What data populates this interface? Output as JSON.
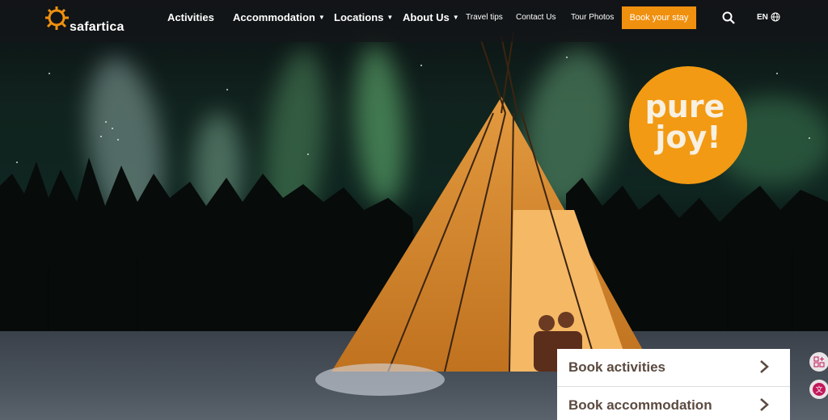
{
  "brand": {
    "name": "safartica"
  },
  "nav": {
    "activities": "Activities",
    "accommodation": "Accommodation",
    "locations": "Locations",
    "about_us": "About Us",
    "travel_tips": "Travel tips",
    "contact_us": "Contact Us",
    "tour_photos": "Tour Photos",
    "book_stay": "Book your stay",
    "language": "EN"
  },
  "badge": {
    "line1": "pure",
    "line2": "joy!"
  },
  "cards": {
    "activities": "Book activities",
    "accommodation": "Book accommodation"
  },
  "colors": {
    "accent": "#f0900f",
    "badge": "#f29a13",
    "card_text": "#5b4a40"
  },
  "icons": [
    "sun-logo-icon",
    "search-icon",
    "globe-icon",
    "chevron-right-icon",
    "chevron-down-icon"
  ]
}
